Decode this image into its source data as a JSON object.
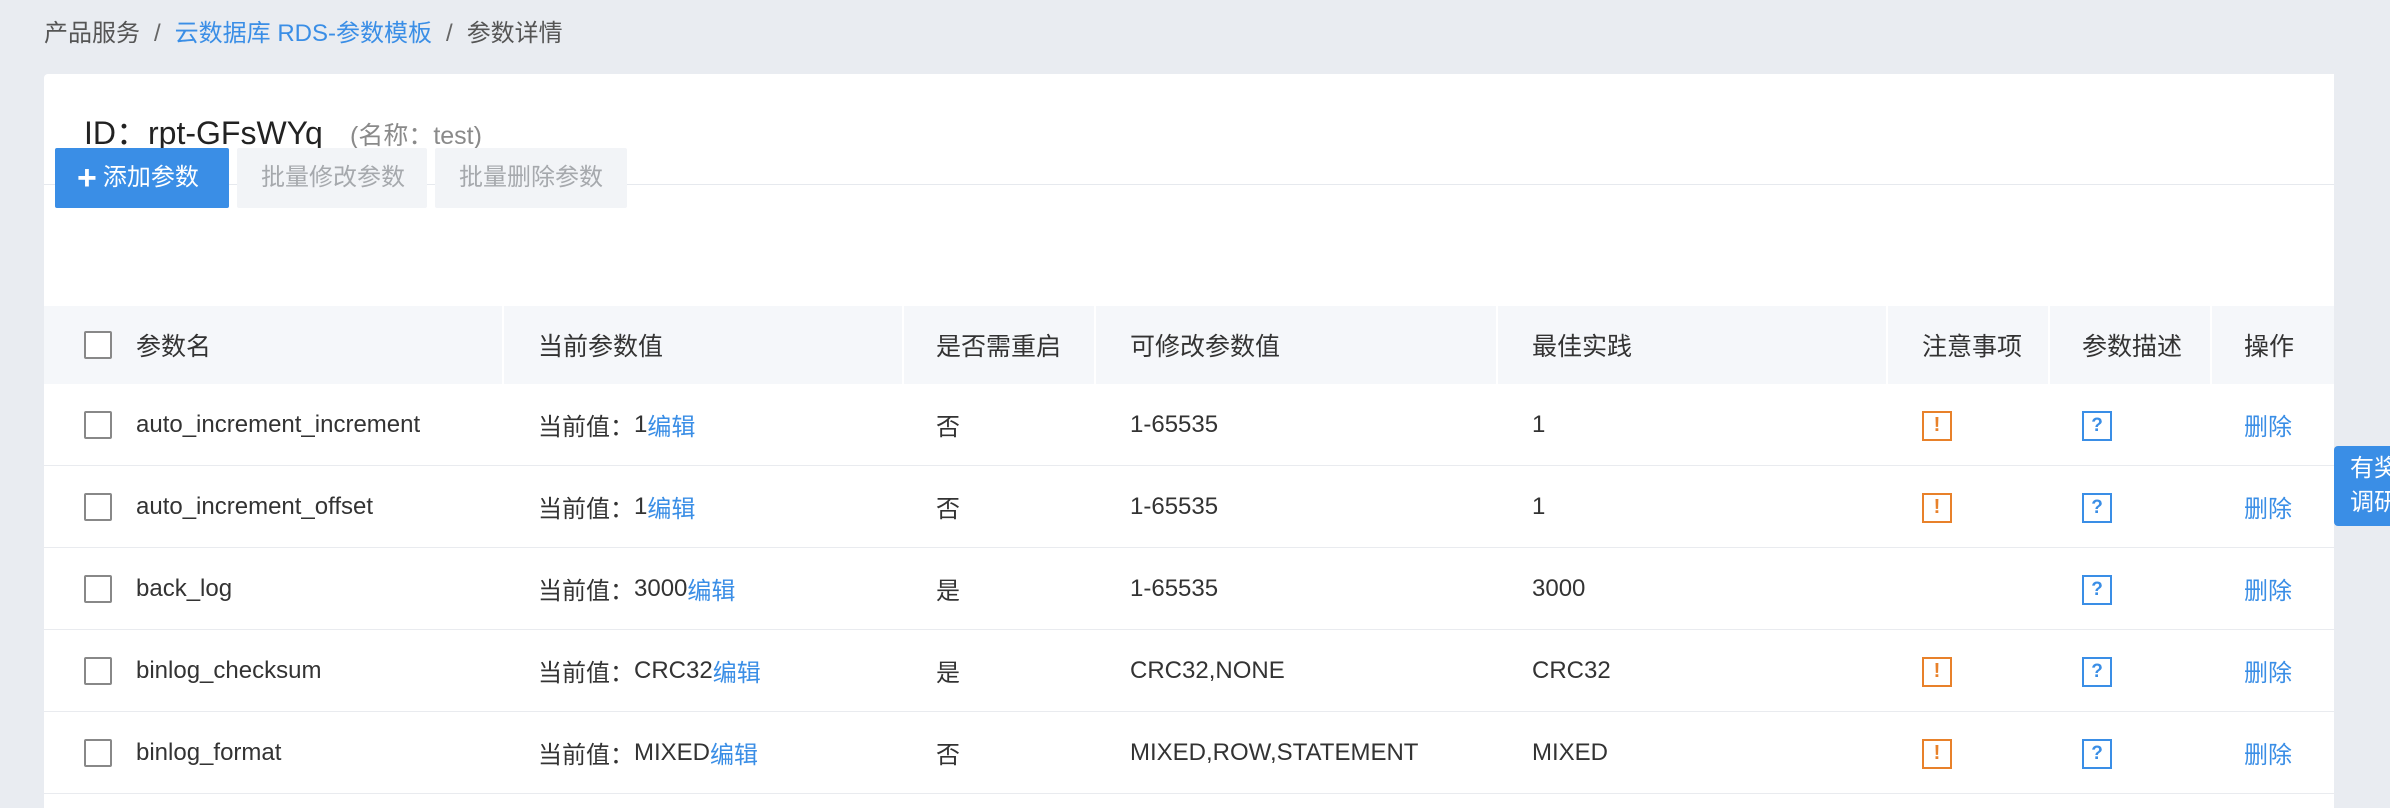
{
  "breadcrumb": {
    "root": "产品服务",
    "parent": "云数据库 RDS-参数模板",
    "current": "参数详情",
    "separator": "/"
  },
  "header": {
    "id_label": "ID：rpt-GFsWYq",
    "name_label": "(名称：test)"
  },
  "toolbar": {
    "add_label": "添加参数",
    "batch_edit_label": "批量修改参数",
    "batch_delete_label": "批量删除参数"
  },
  "table": {
    "columns": {
      "name": "参数名",
      "current": "当前参数值",
      "restart": "是否需重启",
      "range": "可修改参数值",
      "best": "最佳实践",
      "note": "注意事项",
      "desc": "参数描述",
      "op": "操作"
    },
    "current_prefix": "当前值：",
    "edit_label": "编辑",
    "delete_label": "删除",
    "rows": [
      {
        "name": "auto_increment_increment",
        "value": "1",
        "restart": "否",
        "range": "1-65535",
        "best": "1",
        "has_note": true
      },
      {
        "name": "auto_increment_offset",
        "value": "1",
        "restart": "否",
        "range": "1-65535",
        "best": "1",
        "has_note": true
      },
      {
        "name": "back_log",
        "value": "3000",
        "restart": "是",
        "range": "1-65535",
        "best": "3000",
        "has_note": false
      },
      {
        "name": "binlog_checksum",
        "value": "CRC32",
        "restart": "是",
        "range": "CRC32,NONE",
        "best": "CRC32",
        "has_note": true
      },
      {
        "name": "binlog_format",
        "value": "MIXED",
        "restart": "否",
        "range": "MIXED,ROW,STATEMENT",
        "best": "MIXED",
        "has_note": true
      }
    ]
  },
  "icons": {
    "warn_glyph": "!",
    "help_glyph": "?",
    "plus_glyph": "+"
  },
  "survey": {
    "line1": "有奖",
    "line2": "调研"
  },
  "colors": {
    "accent": "#3a8ee6",
    "warning": "#e8812a",
    "background": "#e9ecf1"
  }
}
